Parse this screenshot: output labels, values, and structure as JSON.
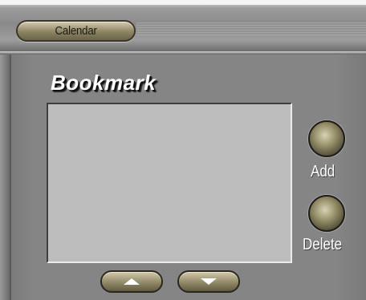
{
  "header": {
    "tab_label": "Calendar"
  },
  "bookmark": {
    "title": "Bookmark",
    "items": [],
    "add_label": "Add",
    "delete_label": "Delete"
  },
  "icons": {
    "scroll_up": "up-arrow-icon",
    "scroll_down": "down-arrow-icon"
  },
  "colors": {
    "panel": "#858585",
    "listbox": "#bdbdbd",
    "button_bronze": "#918967"
  }
}
